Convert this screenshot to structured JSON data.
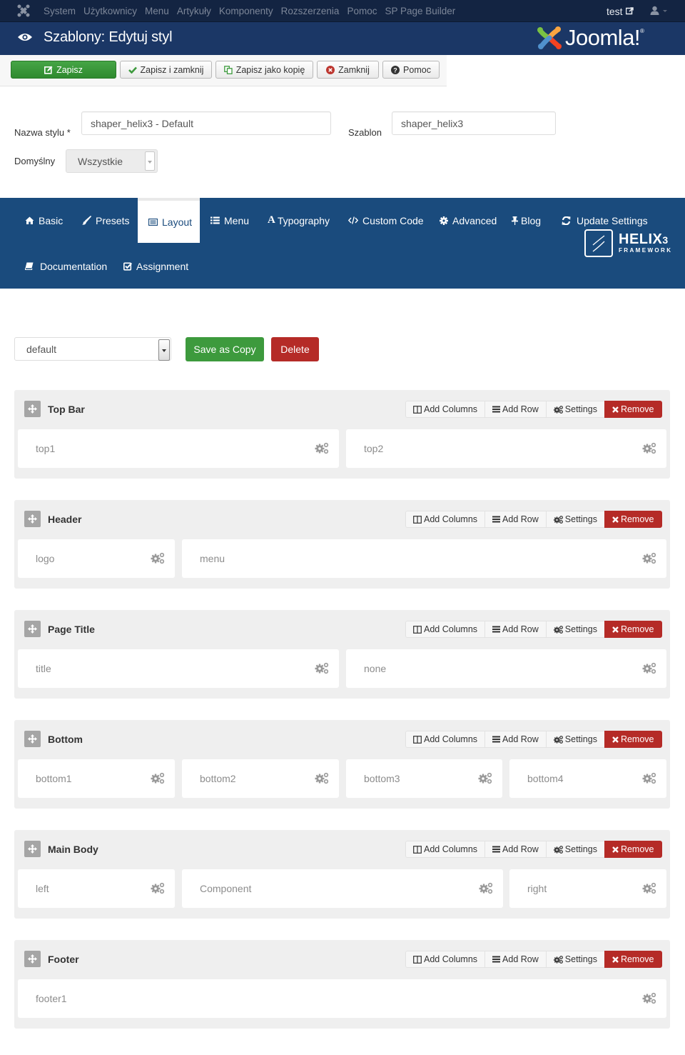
{
  "topnav": {
    "logo_icon": "joomla-icon",
    "menu": [
      "System",
      "Użytkownicy",
      "Menu",
      "Artykuły",
      "Komponenty",
      "Rozszerzenia",
      "Pomoc",
      "SP Page Builder"
    ],
    "site_link": "test",
    "site_link_icon": "external-link-icon",
    "user_icon": "user-icon"
  },
  "header": {
    "icon": "eye-icon",
    "title": "Szablony: Edytuj styl",
    "brand": "Joomla!",
    "brand_reg": "®"
  },
  "toolbar": {
    "buttons": [
      {
        "label": "Zapisz",
        "icon": "edit-icon"
      },
      {
        "label": "Zapisz i zamknij",
        "icon": "check-icon"
      },
      {
        "label": "Zapisz jako kopię",
        "icon": "copy-icon"
      },
      {
        "label": "Zamknij",
        "icon": "close-circle-icon"
      },
      {
        "label": "Pomoc",
        "icon": "question-icon"
      }
    ]
  },
  "form": {
    "style_name_label": "Nazwa stylu *",
    "style_name_value": "shaper_helix3 - Default",
    "template_label": "Szablon",
    "template_value": "shaper_helix3",
    "default_label": "Domyślny",
    "default_value": "Wszystkie"
  },
  "tabs": [
    {
      "label": "Basic",
      "icon": "home-icon"
    },
    {
      "label": "Presets",
      "icon": "brush-icon"
    },
    {
      "label": "Layout",
      "icon": "layout-icon",
      "active": true
    },
    {
      "label": "Menu",
      "icon": "list-icon"
    },
    {
      "label": "Typography",
      "icon": "font-icon"
    },
    {
      "label": "Custom Code",
      "icon": "code-icon"
    },
    {
      "label": "Advanced",
      "icon": "cog-icon"
    },
    {
      "label": "Blog",
      "icon": "pin-icon"
    },
    {
      "label": "Update Settings",
      "icon": "refresh-icon"
    },
    {
      "label": "Documentation",
      "icon": "book-icon"
    },
    {
      "label": "Assignment",
      "icon": "checkbox-icon"
    }
  ],
  "helix": {
    "name": "HELIX",
    "version": "3",
    "sub": "FRAMEWORK"
  },
  "layout_controls": {
    "selected_layout": "default",
    "save_copy_label": "Save as Copy",
    "delete_label": "Delete"
  },
  "row_actions": {
    "add_columns": "Add Columns",
    "add_row": "Add Row",
    "settings": "Settings",
    "remove": "Remove"
  },
  "sections": [
    {
      "title": "Top Bar",
      "columns": [
        "top1",
        "top2"
      ]
    },
    {
      "title": "Header",
      "columns": [
        "logo",
        "menu"
      ]
    },
    {
      "title": "Page Title",
      "columns": [
        "title",
        "none"
      ]
    },
    {
      "title": "Bottom",
      "columns": [
        "bottom1",
        "bottom2",
        "bottom3",
        "bottom4"
      ]
    },
    {
      "title": "Main Body",
      "columns": [
        "left",
        "Component",
        "right"
      ]
    },
    {
      "title": "Footer",
      "columns": [
        "footer1"
      ]
    }
  ],
  "colors": {
    "topnav_bg": "#132442",
    "header_bg": "#1b3766",
    "tabs_bg": "#1a4b7d",
    "success": "#3d9a3d",
    "danger": "#b52b27"
  }
}
